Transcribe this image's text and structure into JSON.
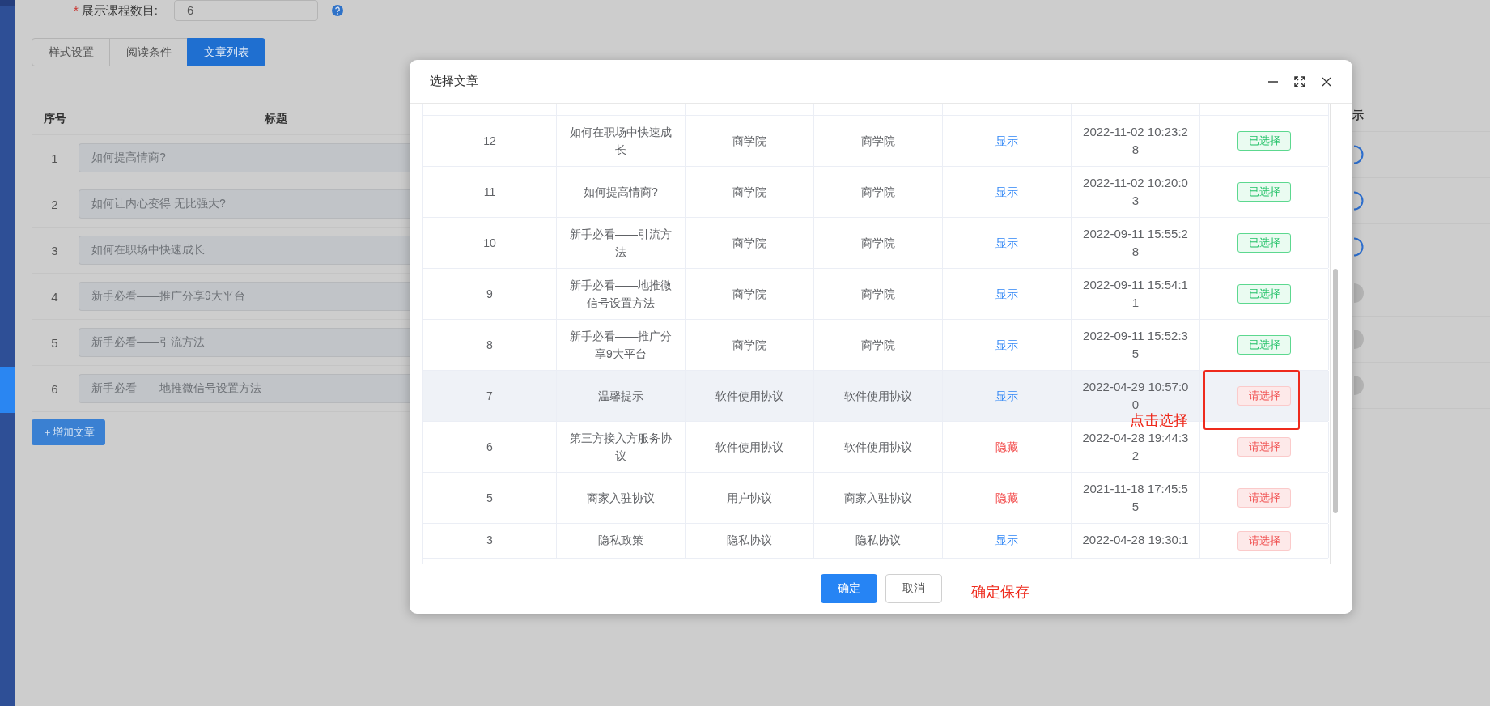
{
  "sidebar": {
    "items": [
      {
        "selected": true
      }
    ]
  },
  "form": {
    "required_mark": "*",
    "label": "展示课程数目:",
    "value": "6"
  },
  "tabs": [
    {
      "label": "样式设置",
      "selected": false
    },
    {
      "label": "阅读条件",
      "selected": false
    },
    {
      "label": "文章列表",
      "selected": true
    }
  ],
  "article_table": {
    "columns": [
      "序号",
      "标题"
    ],
    "right_column_header": "示",
    "rows": [
      {
        "number": "1",
        "title": "如何提高情商?",
        "on": true
      },
      {
        "number": "2",
        "title": "如何让内心变得 无比强大?",
        "on": true
      },
      {
        "number": "3",
        "title": "如何在职场中快速成长",
        "on": true
      },
      {
        "number": "4",
        "title": "新手必看——推广分享9大平台",
        "on": false
      },
      {
        "number": "5",
        "title": "新手必看——引流方法",
        "on": false
      },
      {
        "number": "6",
        "title": "新手必看——地推微信号设置方法",
        "on": false
      }
    ]
  },
  "add_button": "＋增加文章",
  "dialog": {
    "title": "选择文章",
    "rows": [
      {
        "column_1": "12",
        "column_2": "如何在职场中快速成长",
        "column_3": "商学院",
        "column_4": "商学院",
        "column_5": {
          "text": "显示",
          "shown": true
        },
        "column_6": "2022-11-02 10:23:28",
        "column_7": {
          "text": "已选择",
          "selected": true
        },
        "hovered": false
      },
      {
        "column_1": "11",
        "column_2": "如何提高情商?",
        "column_3": "商学院",
        "column_4": "商学院",
        "column_5": {
          "text": "显示",
          "shown": true
        },
        "column_6": "2022-11-02 10:20:03",
        "column_7": {
          "text": "已选择",
          "selected": true
        },
        "hovered": false
      },
      {
        "column_1": "10",
        "column_2": "新手必看——引流方法",
        "column_3": "商学院",
        "column_4": "商学院",
        "column_5": {
          "text": "显示",
          "shown": true
        },
        "column_6": "2022-09-11 15:55:28",
        "column_7": {
          "text": "已选择",
          "selected": true
        },
        "hovered": false
      },
      {
        "column_1": "9",
        "column_2": "新手必看——地推微信号设置方法",
        "column_3": "商学院",
        "column_4": "商学院",
        "column_5": {
          "text": "显示",
          "shown": true
        },
        "column_6": "2022-09-11 15:54:11",
        "column_7": {
          "text": "已选择",
          "selected": true
        },
        "hovered": false
      },
      {
        "column_1": "8",
        "column_2": "新手必看——推广分享9大平台",
        "column_3": "商学院",
        "column_4": "商学院",
        "column_5": {
          "text": "显示",
          "shown": true
        },
        "column_6": "2022-09-11 15:52:35",
        "column_7": {
          "text": "已选择",
          "selected": true
        },
        "hovered": false
      },
      {
        "column_1": "7",
        "column_2": "温馨提示",
        "column_3": "软件使用协议",
        "column_4": "软件使用协议",
        "column_5": {
          "text": "显示",
          "shown": true
        },
        "column_6": "2022-04-29 10:57:00",
        "column_7": {
          "text": "请选择",
          "selected": false
        },
        "hovered": true
      },
      {
        "column_1": "6",
        "column_2": "第三方接入方服务协议",
        "column_3": "软件使用协议",
        "column_4": "软件使用协议",
        "column_5": {
          "text": "隐藏",
          "shown": false
        },
        "column_6": "2022-04-28 19:44:32",
        "column_7": {
          "text": "请选择",
          "selected": false
        },
        "hovered": false
      },
      {
        "column_1": "5",
        "column_2": "商家入驻协议",
        "column_3": "用户协议",
        "column_4": "商家入驻协议",
        "column_5": {
          "text": "隐藏",
          "shown": false
        },
        "column_6": "2021-11-18 17:45:55",
        "column_7": {
          "text": "请选择",
          "selected": false
        },
        "hovered": false
      },
      {
        "column_1": "3",
        "column_2": "隐私政策",
        "column_3": "隐私协议",
        "column_4": "隐私协议",
        "column_5": {
          "text": "显示",
          "shown": true
        },
        "column_6": "2022-04-28 19:30:1",
        "column_7": {
          "text": "请选择",
          "selected": false
        },
        "hovered": false
      }
    ],
    "buttons": [
      {
        "label": "确定",
        "kind": "primary"
      },
      {
        "label": "取消",
        "kind": "default"
      }
    ],
    "annotations": [
      {
        "text": "点击选择",
        "kind": "row"
      },
      {
        "text": "确定保存",
        "kind": "footer"
      }
    ]
  }
}
